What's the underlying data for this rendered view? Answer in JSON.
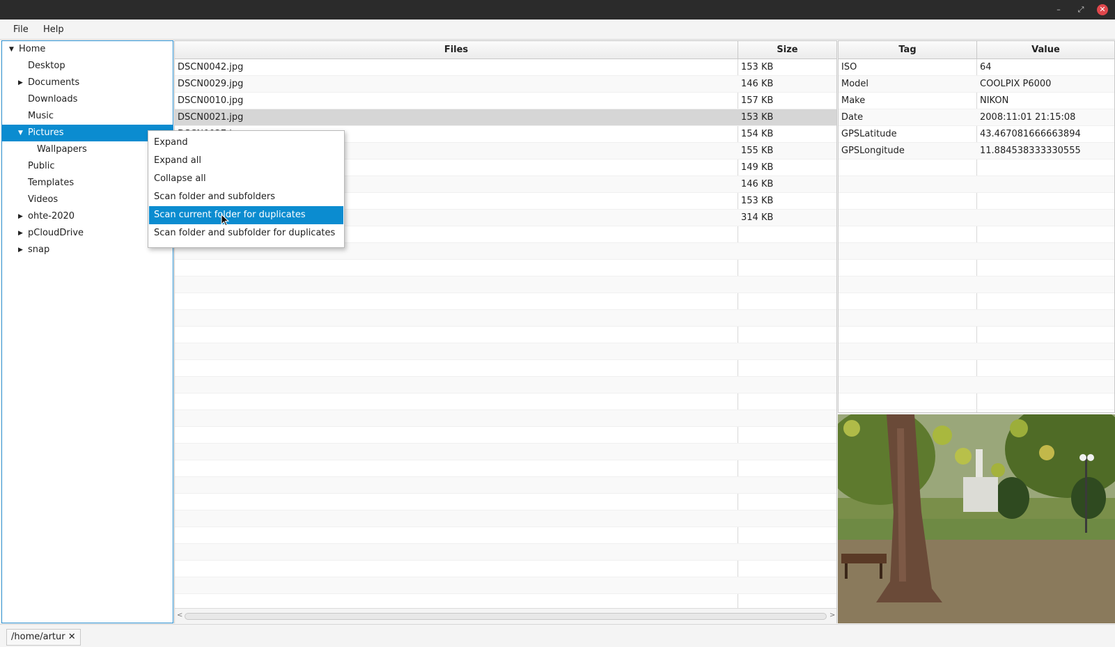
{
  "window": {
    "minimize": "–",
    "maximize": "⤢",
    "close": "✕"
  },
  "menu": {
    "file": "File",
    "help": "Help"
  },
  "tree": {
    "home": "Home",
    "desktop": "Desktop",
    "documents": "Documents",
    "downloads": "Downloads",
    "music": "Music",
    "pictures": "Pictures",
    "wallpapers": "Wallpapers",
    "public": "Public",
    "templates": "Templates",
    "videos": "Videos",
    "ohte": "ohte-2020",
    "pcloud": "pCloudDrive",
    "snap": "snap"
  },
  "files": {
    "header_files": "Files",
    "header_size": "Size",
    "rows": [
      {
        "name": "DSCN0042.jpg",
        "size": "153 KB"
      },
      {
        "name": "DSCN0029.jpg",
        "size": "146 KB"
      },
      {
        "name": "DSCN0010.jpg",
        "size": "157 KB"
      },
      {
        "name": "DSCN0021.jpg",
        "size": "153 KB"
      },
      {
        "name": "DSCN0027.jpg",
        "size": "154 KB"
      },
      {
        "name": "",
        "size": "155 KB"
      },
      {
        "name": "",
        "size": "149 KB"
      },
      {
        "name": "",
        "size": "146 KB"
      },
      {
        "name": "",
        "size": "153 KB"
      },
      {
        "name": "",
        "size": "314 KB"
      }
    ]
  },
  "tags": {
    "header_tag": "Tag",
    "header_value": "Value",
    "rows": [
      {
        "tag": "ISO",
        "value": "64"
      },
      {
        "tag": "Model",
        "value": "COOLPIX P6000"
      },
      {
        "tag": "Make",
        "value": "NIKON"
      },
      {
        "tag": "Date",
        "value": "2008:11:01 21:15:08"
      },
      {
        "tag": "GPSLatitude",
        "value": "43.467081666663894"
      },
      {
        "tag": "GPSLongitude",
        "value": "11.884538333330555"
      }
    ]
  },
  "context_menu": {
    "expand": "Expand",
    "expand_all": "Expand all",
    "collapse_all": "Collapse all",
    "scan_folder_sub": "Scan folder and subfolders",
    "scan_current_dup": "Scan current folder for duplicates",
    "scan_folder_sub_dup": "Scan folder and subfolder for duplicates"
  },
  "status": {
    "path": "/home/artur",
    "close_icon": "✕"
  }
}
